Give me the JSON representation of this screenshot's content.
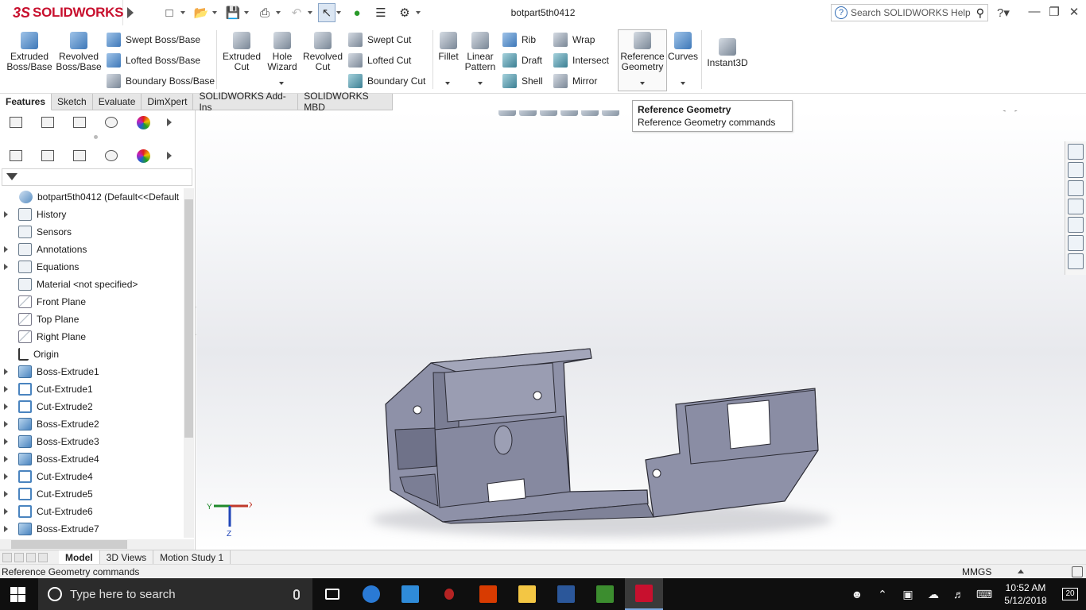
{
  "app": {
    "logo_prefix": "3S",
    "logo_text": "SOLIDWORKS",
    "document_title": "botpart5th0412",
    "help_search_placeholder": "Search SOLIDWORKS Help"
  },
  "quick_access": {
    "icons": [
      "new-document-icon",
      "open-icon",
      "save-icon",
      "print-icon",
      "undo-icon",
      "select-icon",
      "rebuild-icon",
      "file-properties-icon",
      "options-icon"
    ]
  },
  "ribbon": {
    "extruded_boss": "Extruded\nBoss/Base",
    "extruded_boss_lines": [
      "Extruded",
      "Boss/Base"
    ],
    "revolved_boss_lines": [
      "Revolved",
      "Boss/Base"
    ],
    "swept_boss": "Swept Boss/Base",
    "lofted_boss": "Lofted Boss/Base",
    "boundary_boss": "Boundary Boss/Base",
    "extruded_cut_lines": [
      "Extruded",
      "Cut"
    ],
    "hole_wizard_lines": [
      "Hole",
      "Wizard"
    ],
    "revolved_cut_lines": [
      "Revolved",
      "Cut"
    ],
    "swept_cut": "Swept Cut",
    "lofted_cut": "Lofted Cut",
    "boundary_cut": "Boundary Cut",
    "fillet": "Fillet",
    "linear_pattern_lines": [
      "Linear",
      "Pattern"
    ],
    "rib": "Rib",
    "draft": "Draft",
    "shell": "Shell",
    "wrap": "Wrap",
    "intersect": "Intersect",
    "mirror": "Mirror",
    "reference_geometry_lines": [
      "Reference",
      "Geometry"
    ],
    "curves": "Curves",
    "instant3d": "Instant3D"
  },
  "command_tabs": [
    {
      "label": "Features",
      "active": true
    },
    {
      "label": "Sketch",
      "active": false
    },
    {
      "label": "Evaluate",
      "active": false
    },
    {
      "label": "DimXpert",
      "active": false
    },
    {
      "label": "SOLIDWORKS Add-Ins",
      "active": false
    },
    {
      "label": "SOLIDWORKS MBD",
      "active": false
    }
  ],
  "tooltip": {
    "title": "Reference Geometry",
    "description": "Reference Geometry commands"
  },
  "feature_tree": {
    "root": "botpart5th0412  (Default<<Default",
    "items": [
      {
        "label": "History",
        "icon": "history-folder-icon",
        "expandable": true
      },
      {
        "label": "Sensors",
        "icon": "sensors-icon",
        "expandable": false
      },
      {
        "label": "Annotations",
        "icon": "annotations-icon",
        "expandable": true
      },
      {
        "label": "Equations",
        "icon": "equations-icon",
        "expandable": true
      },
      {
        "label": "Material <not specified>",
        "icon": "material-icon",
        "expandable": false
      },
      {
        "label": "Front Plane",
        "icon": "plane-icon",
        "expandable": false
      },
      {
        "label": "Top Plane",
        "icon": "plane-icon",
        "expandable": false
      },
      {
        "label": "Right Plane",
        "icon": "plane-icon",
        "expandable": false
      },
      {
        "label": "Origin",
        "icon": "origin-icon",
        "expandable": false
      },
      {
        "label": "Boss-Extrude1",
        "icon": "boss-extrude-icon",
        "expandable": true
      },
      {
        "label": "Cut-Extrude1",
        "icon": "cut-extrude-icon",
        "expandable": true
      },
      {
        "label": "Cut-Extrude2",
        "icon": "cut-extrude-icon",
        "expandable": true
      },
      {
        "label": "Boss-Extrude2",
        "icon": "boss-extrude-icon",
        "expandable": true
      },
      {
        "label": "Boss-Extrude3",
        "icon": "boss-extrude-icon",
        "expandable": true
      },
      {
        "label": "Boss-Extrude4",
        "icon": "boss-extrude-icon",
        "expandable": true
      },
      {
        "label": "Cut-Extrude4",
        "icon": "cut-extrude-icon",
        "expandable": true
      },
      {
        "label": "Cut-Extrude5",
        "icon": "cut-extrude-icon",
        "expandable": true
      },
      {
        "label": "Cut-Extrude6",
        "icon": "cut-extrude-icon",
        "expandable": true
      },
      {
        "label": "Boss-Extrude7",
        "icon": "boss-extrude-icon",
        "expandable": true
      }
    ]
  },
  "triad": {
    "x": "X",
    "y": "Y",
    "z": "Z"
  },
  "model_tabs": [
    {
      "label": "Model",
      "active": true
    },
    {
      "label": "3D Views",
      "active": false
    },
    {
      "label": "Motion Study 1",
      "active": false
    }
  ],
  "status": {
    "message": "Reference Geometry commands",
    "units": "MMGS"
  },
  "taskbar": {
    "search_placeholder": "Type here to search",
    "time": "10:52 AM",
    "date": "5/12/2018",
    "notifications": "20",
    "apps": [
      "task-view-icon",
      "edge-icon",
      "store-icon",
      "app-bug-icon",
      "office-icon",
      "file-explorer-icon",
      "word-icon",
      "app-board-icon",
      "solidworks-icon"
    ]
  },
  "colors": {
    "brand_red": "#c8102e",
    "part_body": "#8c8fa6",
    "accent_blue": "#3e78b8"
  }
}
